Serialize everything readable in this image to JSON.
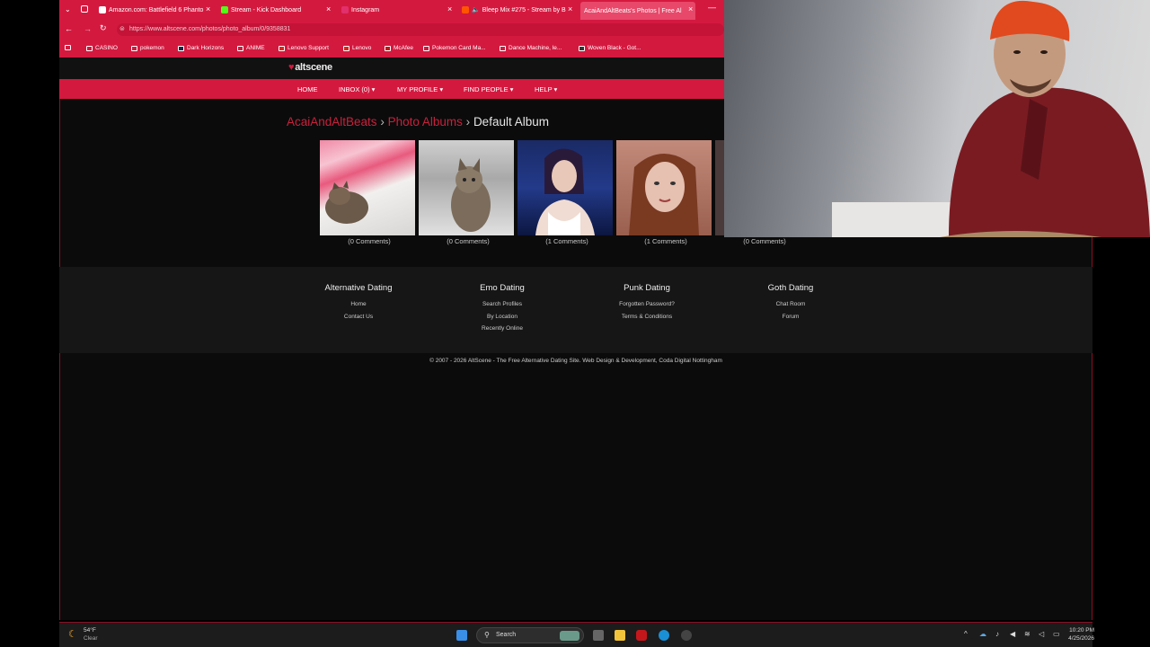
{
  "browser": {
    "tabs": [
      {
        "label": "Amazon.com: Battlefield 6 Phanto",
        "favicon_color": "#ffffff"
      },
      {
        "label": "Stream - Kick Dashboard",
        "favicon_color": "#53fc18"
      },
      {
        "label": "Instagram",
        "favicon_color": "#e1306c"
      },
      {
        "label": "Bleep Mix #275 - Stream by B",
        "favicon_color": "#ff5500"
      },
      {
        "label": "AcaiAndAltBeats's Photos | Free Al",
        "favicon_color": "#d4193f"
      }
    ],
    "url": "https://www.altscene.com/photos/photo_album/0/9358831",
    "bookmarks": [
      "CASINO",
      "pokemon",
      "Dark Horizons",
      "ANIME",
      "Lenovo Support",
      "Lenovo",
      "McAfee",
      "Pokemon Card Ma...",
      "Dance Machine, le...",
      "Woven Black - Got..."
    ]
  },
  "site": {
    "logo": "altscene",
    "nav": [
      "HOME",
      "INBOX (0) ▾",
      "MY PROFILE ▾",
      "FIND PEOPLE ▾",
      "HELP ▾"
    ],
    "breadcrumb": {
      "user": "AcaiAndAltBeats",
      "albums": "Photo Albums",
      "current": "Default Album",
      "separator": "›"
    },
    "photos": [
      {
        "comments": "(0 Comments)",
        "subject": "cat-on-pink-pillow"
      },
      {
        "comments": "(0 Comments)",
        "subject": "tabby-cat"
      },
      {
        "comments": "(1 Comments)",
        "subject": "dark-haired-woman"
      },
      {
        "comments": "(1 Comments)",
        "subject": "red-haired-woman"
      },
      {
        "comments": "(0 Comments)",
        "subject": "hidden"
      }
    ],
    "footer": [
      {
        "title": "Alternative Dating",
        "links": [
          "Home",
          "Contact Us"
        ]
      },
      {
        "title": "Emo Dating",
        "links": [
          "Search Profiles",
          "By Location",
          "Recently Online"
        ]
      },
      {
        "title": "Punk Dating",
        "links": [
          "Forgotten Password?",
          "Terms & Conditions"
        ]
      },
      {
        "title": "Goth Dating",
        "links": [
          "Chat Room",
          "Forum"
        ]
      }
    ],
    "copyright": "© 2007 - 2026 AltScene - The Free Alternative Dating Site. Web Design & Development, Coda Digital Nottingham"
  },
  "taskbar": {
    "weather_temp": "54°F",
    "weather_desc": "Clear",
    "search_label": "Search",
    "time": "10:20 PM",
    "date": "4/25/2026"
  },
  "colors": {
    "accent": "#d4193f",
    "link": "#c8213c"
  }
}
